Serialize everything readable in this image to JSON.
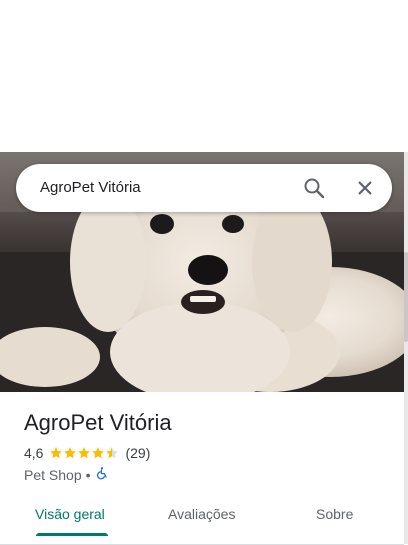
{
  "search": {
    "query": "AgroPet Vitória"
  },
  "place": {
    "name": "AgroPet Vitória",
    "rating": "4,6",
    "rating_value": 4.6,
    "review_count": "(29)",
    "category": "Pet Shop",
    "separator": "•"
  },
  "tabs": [
    {
      "label": "Visão geral",
      "active": true
    },
    {
      "label": "Avaliações",
      "active": false
    },
    {
      "label": "Sobre",
      "active": false
    }
  ],
  "colors": {
    "accent": "#00796b",
    "star": "#fbbc04",
    "accessibility": "#1a73e8"
  },
  "icons": {
    "search": "search-icon",
    "close": "close-icon",
    "accessibility": "wheelchair-icon"
  }
}
